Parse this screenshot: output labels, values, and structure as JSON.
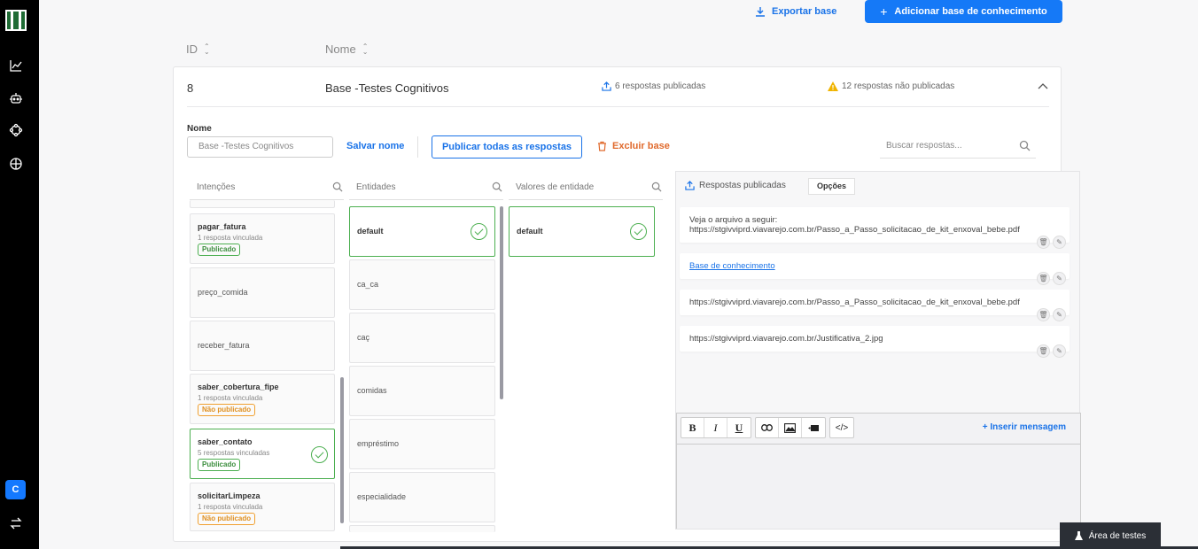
{
  "header": {
    "export_label": "Exportar base",
    "add_label": "Adicionar base de conhecimento"
  },
  "columns": {
    "id": "ID",
    "name": "Nome"
  },
  "row": {
    "id": "8",
    "name": "Base -Testes Cognitivos",
    "published": "6 respostas publicadas",
    "unpublished": "12 respostas não publicadas"
  },
  "edit": {
    "name_label": "Nome",
    "name_placeholder": "Base -Testes Cognitivos",
    "save_name": "Salvar nome",
    "publish_all": "Publicar todas as respostas",
    "delete_base": "Excluir base",
    "search_placeholder": "Buscar respostas..."
  },
  "lists": {
    "intents_header": "Intenções",
    "entities_header": "Entidades",
    "values_header": "Valores de entidade",
    "intents": [
      {
        "name": "pagar_fatura",
        "sub": "1 resposta vinculada",
        "badge": "Publicado"
      },
      {
        "name": "preço_comida"
      },
      {
        "name": "receber_fatura"
      },
      {
        "name": "saber_cobertura_fipe",
        "sub": "1 resposta vinculada",
        "badge": "Não publicado"
      },
      {
        "name": "saber_contato",
        "sub": "5 respostas vinculadas",
        "badge": "Publicado"
      },
      {
        "name": "solicitarLimpeza",
        "sub": "1 resposta vinculada",
        "badge": "Não publicado"
      }
    ],
    "entities": [
      "default",
      "ca_ca",
      "caç",
      "comidas",
      "empréstimo",
      "especialidade"
    ],
    "values": [
      "default"
    ]
  },
  "responses": {
    "tab_label": "Respostas publicadas",
    "options_label": "Opções",
    "items": [
      {
        "line1": "Veja o arquivo a seguir:",
        "line2": "https://stgivviprd.viavarejo.com.br/Passo_a_Passo_solicitacao_de_kit_enxoval_bebe.pdf"
      },
      {
        "line1": "Base de conhecimento"
      },
      {
        "line1": "https://stgivviprd.viavarejo.com.br/Passo_a_Passo_solicitacao_de_kit_enxoval_bebe.pdf"
      },
      {
        "line1": "https://stgivviprd.viavarejo.com.br/Justificativa_2.jpg"
      }
    ],
    "insert_message": "+ Inserir mensagem"
  },
  "editor_toolbar": {
    "bold": "B",
    "italic": "I",
    "underline": "U",
    "code": "</>"
  },
  "sidebar": {
    "avatar_letter": "C"
  },
  "footer": {
    "test_area": "Área de testes"
  }
}
